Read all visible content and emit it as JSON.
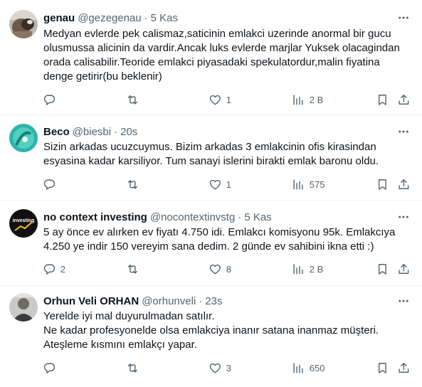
{
  "accent_color": "#1d9bf0",
  "tweets": [
    {
      "name": "genau",
      "handle": "@gezegenau",
      "time": "5 Kas",
      "lines": [
        "Medyan evlerde pek calismaz,saticinin emlakci uzerinde anormal bir gucu",
        "olusmussa alicinin da vardir.Ancak luks evlerde marjlar Yuksek olacagindan",
        "orada calisabilir.Teoride emlakci piyasadaki spekulatordur,malin fiyatina",
        "denge getirir(bu beklenir)"
      ],
      "replies": "",
      "retweets": "",
      "likes": "1",
      "views": "2 B"
    },
    {
      "name": "Beco",
      "handle": "@biesbi",
      "time": "20s",
      "lines": [
        "Sizin arkadas ucuzcuymus. Bizim arkadas 3 emlakcinin ofis kirasindan",
        "esyasina kadar karsiliyor. Tum sanayi islerini birakti emlak baronu oldu."
      ],
      "replies": "",
      "retweets": "",
      "likes": "1",
      "views": "575"
    },
    {
      "name": "no context investing",
      "handle": "@nocontextinvstg",
      "time": "5 Kas",
      "avatar_text": "investing",
      "lines": [
        "5 ay önce ev alırken ev fiyatı 4.750 idi. Emlakcı komisyonu 95k. Emlakcıya",
        "4.250 ye indir 150 vereyim sana dedim. 2 günde ev sahibini ikna etti :)"
      ],
      "replies": "2",
      "retweets": "",
      "likes": "8",
      "views": "2 B"
    },
    {
      "name": "Orhun Veli ORHAN",
      "handle": "@orhunveli",
      "time": "23s",
      "lines": [
        "Yerelde iyi mal duyurulmadan satılır.",
        "Ne kadar profesyonelde olsa emlakciya inanır satana inanmaz müşteri.",
        "Ateşleme kısmını emlakçı yapar."
      ],
      "replies": "",
      "retweets": "",
      "likes": "3",
      "views": "650"
    }
  ]
}
